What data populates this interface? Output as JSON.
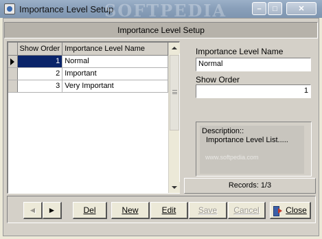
{
  "window": {
    "title": "Importance Level Setup",
    "watermark": "SOFTPEDIA",
    "controls": {
      "minimize": "–",
      "maximize": "□",
      "close": "✕"
    }
  },
  "header": {
    "title": "Importance Level Setup"
  },
  "grid": {
    "columns": [
      "Show Order",
      "Importance Level Name"
    ],
    "rows": [
      {
        "order": "1",
        "name": "Normal"
      },
      {
        "order": "2",
        "name": "Important"
      },
      {
        "order": "3",
        "name": "Very Important"
      }
    ],
    "selected_row": 0
  },
  "form": {
    "name_label": "Importance Level  Name",
    "name_value": "Normal",
    "order_label": "Show Order",
    "order_value": "1",
    "description_label": "Description::",
    "description_value": "Importance Level List.....",
    "watermark": "www.softpedia.com"
  },
  "records": {
    "text": "Records: 1/3"
  },
  "toolbar": {
    "prev_label": "◄",
    "next_label": "►",
    "del_label": "Del",
    "new_label": "New",
    "edit_label": "Edit",
    "save_label": "Save",
    "cancel_label": "Cancel",
    "close_label": "Close"
  }
}
